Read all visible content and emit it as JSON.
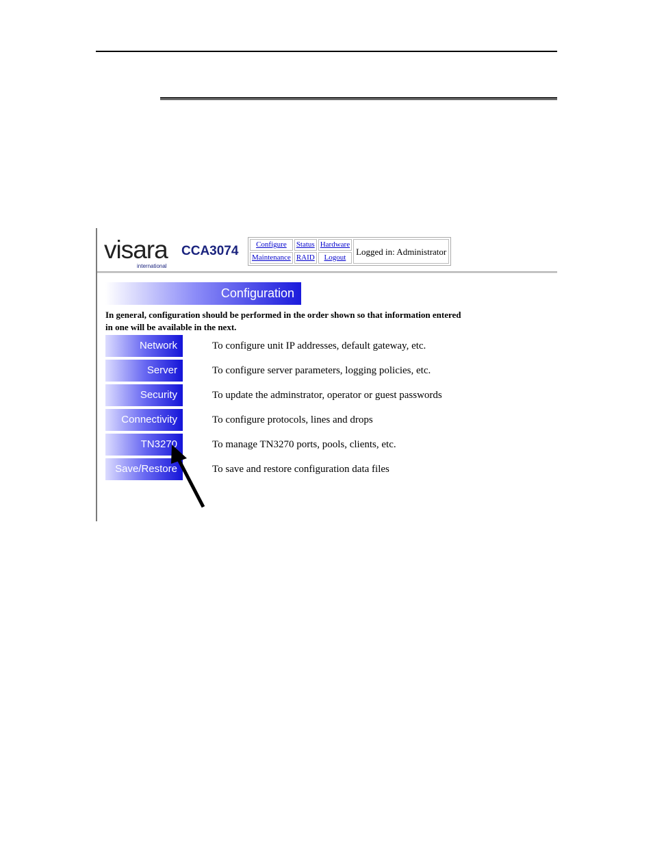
{
  "brand": {
    "logo_word": "visara",
    "logo_sub": "international",
    "product": "CCA3074"
  },
  "nav": {
    "configure": "Configure",
    "status": "Status",
    "hardware": "Hardware",
    "maintenance": "Maintenance",
    "raid": "RAID",
    "logout": "Logout",
    "logged_in": "Logged in: Administrator"
  },
  "section": {
    "title": "Configuration",
    "intro": "In general, configuration should be performed in the order shown so that information entered in one will be available in the next."
  },
  "items": [
    {
      "label": "Network",
      "desc": "To configure unit IP addresses, default gateway, etc."
    },
    {
      "label": "Server",
      "desc": "To configure server parameters, logging policies, etc."
    },
    {
      "label": "Security",
      "desc": "To update the adminstrator, operator or guest passwords"
    },
    {
      "label": "Connectivity",
      "desc": "To configure protocols, lines and drops"
    },
    {
      "label": "TN3270",
      "desc": "To manage TN3270 ports, pools, clients, etc."
    },
    {
      "label": "Save/Restore",
      "desc": "To save and restore configuration data files"
    }
  ],
  "colors": {
    "brand_blue": "#1a237e",
    "button_blue": "#1414d8",
    "link_blue": "#0000cc"
  }
}
